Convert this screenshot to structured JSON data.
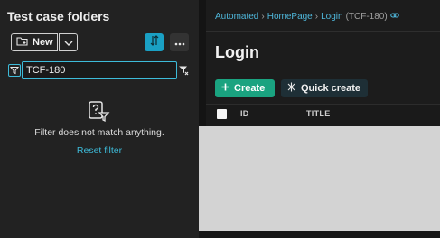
{
  "left_panel": {
    "title": "Test case folders",
    "new_label": "New",
    "filter_value": "TCF-180",
    "empty_message": "Filter does not match anything.",
    "reset_label": "Reset filter"
  },
  "breadcrumb": {
    "items": [
      "Automated",
      "HomePage",
      "Login"
    ],
    "key": "(TCF-180)"
  },
  "main": {
    "title": "Login",
    "create_label": "Create",
    "quick_create_label": "Quick create"
  },
  "table": {
    "columns": [
      "ID",
      "TITLE"
    ]
  },
  "colors": {
    "accent": "#3dbbd9",
    "create": "#1aa380",
    "background": "#1f1f1f"
  }
}
